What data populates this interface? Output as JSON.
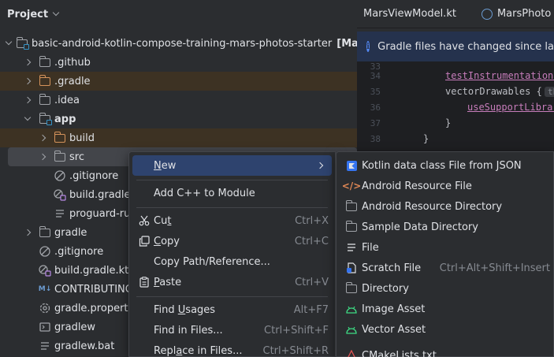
{
  "project_panel": {
    "title": "Project",
    "tree": [
      {
        "name": "basic-android-kotlin-compose-training-mars-photos-starter",
        "suffix": "[Ma",
        "expanded": true,
        "kind": "root"
      },
      {
        "name": ".github",
        "expanded": false,
        "kind": "folder"
      },
      {
        "name": ".gradle",
        "expanded": false,
        "kind": "folder-excluded"
      },
      {
        "name": ".idea",
        "expanded": false,
        "kind": "folder"
      },
      {
        "name": "app",
        "expanded": true,
        "kind": "module"
      },
      {
        "name": "build",
        "expanded": false,
        "kind": "folder-excluded"
      },
      {
        "name": "src",
        "expanded": false,
        "kind": "folder"
      },
      {
        "name": ".gitignore",
        "kind": "file-ignore"
      },
      {
        "name": "build.gradle",
        "kind": "file-gradle"
      },
      {
        "name": "proguard-ru",
        "kind": "file-text"
      },
      {
        "name": "gradle",
        "expanded": false,
        "kind": "folder"
      },
      {
        "name": ".gitignore",
        "kind": "file-ignore"
      },
      {
        "name": "build.gradle.kts",
        "kind": "file-gradle"
      },
      {
        "name": "CONTRIBUTING",
        "kind": "file-md"
      },
      {
        "name": "gradle.properti",
        "kind": "file-settings"
      },
      {
        "name": "gradlew",
        "kind": "file-terminal"
      },
      {
        "name": "gradlew.bat",
        "kind": "file-text"
      }
    ]
  },
  "editor": {
    "tabs": [
      {
        "label": "MarsViewModel.kt"
      },
      {
        "label": "MarsPhoto"
      }
    ],
    "notice": "Gradle files have changed since la",
    "lines": [
      {
        "num": "33",
        "text": ""
      },
      {
        "num": "34",
        "text": "testInstrumentationR"
      },
      {
        "num": "35",
        "text": "vectorDrawables {",
        "hint": "th"
      },
      {
        "num": "36",
        "text": "useSupportLibrar"
      },
      {
        "num": "37",
        "text": "}"
      },
      {
        "num": "38",
        "text": "}"
      }
    ]
  },
  "context_menu": {
    "items": [
      {
        "label": "New",
        "mnemonic": "N",
        "rest": "ew",
        "has_submenu": true,
        "highlighted": true
      },
      {
        "label": "Add C++ to Module"
      },
      {
        "label": "Cut",
        "mnemonic": "t",
        "pre": "Cu",
        "shortcut": "Ctrl+X",
        "icon": "scissors-icon"
      },
      {
        "label": "Copy",
        "mnemonic": "C",
        "rest": "opy",
        "shortcut": "Ctrl+C",
        "icon": "copy-icon"
      },
      {
        "label": "Copy Path/Reference..."
      },
      {
        "label": "Paste",
        "mnemonic": "P",
        "rest": "aste",
        "shortcut": "Ctrl+V",
        "icon": "clipboard-icon"
      },
      {
        "label": "Find Usages",
        "pre": "Find ",
        "mnemonic": "U",
        "rest": "sages",
        "shortcut": "Alt+F7"
      },
      {
        "label": "Find in Files...",
        "shortcut": "Ctrl+Shift+F"
      },
      {
        "label": "Replace in Files...",
        "pre": "Repl",
        "mnemonic": "a",
        "rest": "ce in Files...",
        "shortcut": "Ctrl+Shift+R"
      }
    ]
  },
  "submenu": {
    "items": [
      {
        "label": "Kotlin data class File from JSON",
        "icon": "kotlin-json-icon"
      },
      {
        "label": "Android Resource File",
        "icon": "code-brackets-icon"
      },
      {
        "label": "Android Resource Directory",
        "icon": "folder-icon"
      },
      {
        "label": "Sample Data Directory",
        "icon": "folder-icon"
      },
      {
        "label": "File",
        "icon": "file-icon"
      },
      {
        "label": "Scratch File",
        "shortcut": "Ctrl+Alt+Shift+Insert",
        "icon": "scratch-file-icon"
      },
      {
        "label": "Directory",
        "icon": "folder-icon"
      },
      {
        "label": "Image Asset",
        "icon": "android-icon"
      },
      {
        "label": "Vector Asset",
        "icon": "android-icon"
      },
      {
        "label": "CMakeLists.txt",
        "icon": "cmake-icon"
      }
    ]
  },
  "colors": {
    "background": "#2b2d30",
    "editor_bg": "#1e1f22",
    "highlight": "#2e436e",
    "excluded_row": "#3d3223",
    "android_green": "#3ddc84",
    "folder_orange": "#d5935b"
  }
}
